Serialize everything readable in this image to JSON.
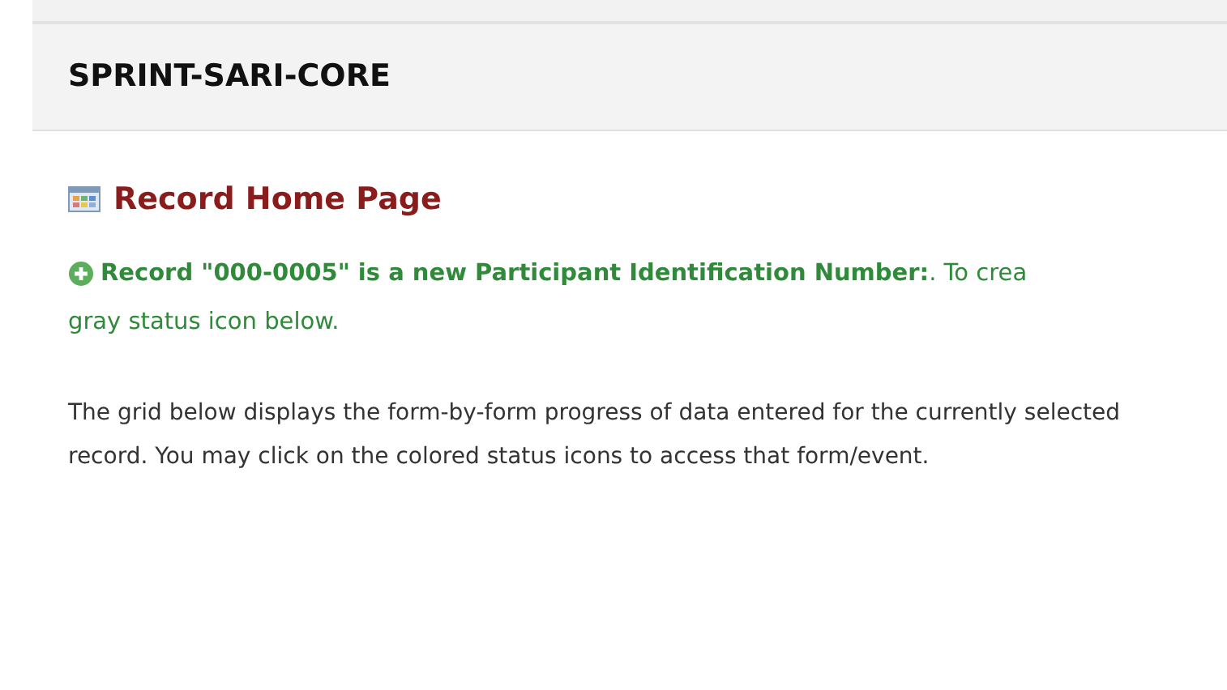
{
  "project": {
    "title": "SPRINT-SARI-CORE"
  },
  "page": {
    "heading": "Record Home Page"
  },
  "message": {
    "lines": [
      "**Record \"000-0005\" is a new Participant Identification Number:**. To crea",
      "gray status icon below."
    ]
  },
  "description": "The grid below displays the form-by-form progress of data entered for the currently selected record. You may click on the colored status icons to access that form/event."
}
